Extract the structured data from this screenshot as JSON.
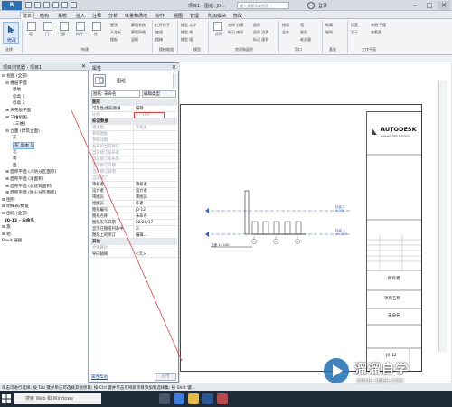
{
  "titlebar": {
    "app_logo": "R",
    "title": "项目1 - 图纸: J0...",
    "search_placeholder": "键入关键字或短语",
    "login": "登录",
    "minimize": "–",
    "maximize": "□",
    "close": "✕"
  },
  "ribbon_tabs": [
    "建筑",
    "结构",
    "系统",
    "插入",
    "注释",
    "分析",
    "体量和场地",
    "协作",
    "视图",
    "管理",
    "附加模块",
    "修改"
  ],
  "ribbon": {
    "modify": "修改",
    "select_panel": "选择",
    "buttons": [
      {
        "label": "墙"
      },
      {
        "label": "门"
      },
      {
        "label": "窗"
      },
      {
        "label": "构件"
      },
      {
        "label": "柱"
      },
      {
        "label": "屋顶"
      },
      {
        "label": "天花板"
      },
      {
        "label": "楼板"
      }
    ],
    "small_labels": [
      "幕墙系统",
      "幕墙网格",
      "竖梃",
      "栏杆扶手",
      "坡道",
      "楼梯",
      "模型 文字",
      "模型 线",
      "模型 组",
      "房间",
      "房间 分隔",
      "标记 房间",
      "面积",
      "面积 边界",
      "标记 面积",
      "按面",
      "竖井",
      "墙",
      "垂直",
      "老虎窗",
      "标高",
      "轴网",
      "设置",
      "显示",
      "参照 平面",
      "查看器"
    ],
    "panels": [
      "构建",
      "楼梯坡道",
      "模型",
      "房间和面积",
      "洞口",
      "基准",
      "工作平面"
    ]
  },
  "browser": {
    "title": "项目浏览器 - 项目1",
    "items": [
      {
        "text": "⊟ 视图 (全部)",
        "indent": 0
      },
      {
        "text": "⊟ 楼层平面",
        "indent": 1
      },
      {
        "text": "场地",
        "indent": 3
      },
      {
        "text": "标高 1",
        "indent": 3
      },
      {
        "text": "标高 2",
        "indent": 3
      },
      {
        "text": "⊞ 天花板平面",
        "indent": 1
      },
      {
        "text": "⊞ 三维视图",
        "indent": 1
      },
      {
        "text": "{三维}",
        "indent": 3
      },
      {
        "text": "⊟ 立面 (建筑立面)",
        "indent": 1
      },
      {
        "text": "东",
        "indent": 3
      },
      {
        "text": "东_副本 1",
        "indent": 3,
        "selected": true
      },
      {
        "text": "北",
        "indent": 3
      },
      {
        "text": "南",
        "indent": 3
      },
      {
        "text": "西",
        "indent": 3
      },
      {
        "text": "⊞ 面积平面 (人防分区面积)",
        "indent": 1
      },
      {
        "text": "⊞ 面积平面 (净面积)",
        "indent": 1
      },
      {
        "text": "⊞ 面积平面 (总建筑面积)",
        "indent": 1
      },
      {
        "text": "⊞ 面积平面 (防火分区面积)",
        "indent": 1
      },
      {
        "text": "⊞ 图例",
        "indent": 0
      },
      {
        "text": "⊞ 明细表/数量",
        "indent": 0
      },
      {
        "text": "⊟ 图纸 (全部)",
        "indent": 0
      },
      {
        "text": "J0-12 - 未命名",
        "indent": 1,
        "bold": true
      },
      {
        "text": "⊞ 族",
        "indent": 0
      },
      {
        "text": "⊞ 组",
        "indent": 0
      },
      {
        "text": "Revit 链接",
        "indent": 0
      }
    ]
  },
  "properties": {
    "title": "属性",
    "close": "✕",
    "type_name": "图纸",
    "filter_value": "图纸: 未命名",
    "edit_type": "编辑类型",
    "group_graphics": "图形",
    "group_identity": "标识数据",
    "group_other": "其他",
    "rows_graphics": [
      {
        "name": "可见性/图形替换",
        "value": "编辑...",
        "dim": false
      },
      {
        "name": "比例",
        "value": "1 : 100",
        "dim": true
      }
    ],
    "rows_identity": [
      {
        "name": "相关性",
        "value": "不相关",
        "dim": true
      },
      {
        "name": "参照图纸",
        "value": "",
        "dim": true
      },
      {
        "name": "参照详图",
        "value": "",
        "dim": true
      },
      {
        "name": "发布的当前修订",
        "value": "",
        "dim": true
      },
      {
        "name": "当前修订发布者",
        "value": "",
        "dim": true
      },
      {
        "name": "当前修订发布到",
        "value": "",
        "dim": true
      },
      {
        "name": "当前修订日期",
        "value": "",
        "dim": true
      },
      {
        "name": "当前修订说明",
        "value": "",
        "dim": true
      },
      {
        "name": "当前修订",
        "value": "",
        "dim": true
      },
      {
        "name": "审核者",
        "value": "审核者",
        "dim": false
      },
      {
        "name": "设计者",
        "value": "设计者",
        "dim": false
      },
      {
        "name": "审图员",
        "value": "审图员",
        "dim": false
      },
      {
        "name": "绘图员",
        "value": "作者",
        "dim": false
      },
      {
        "name": "图纸编号",
        "value": "J0-12",
        "dim": false
      },
      {
        "name": "图纸名称",
        "value": "未命名",
        "dim": false
      },
      {
        "name": "图纸发布日期",
        "value": "02/26/17",
        "dim": false
      },
      {
        "name": "显示在图纸列表中",
        "value": "☑",
        "dim": false
      },
      {
        "name": "图纸上的修订",
        "value": "编辑...",
        "dim": false
      }
    ],
    "rows_other": [
      {
        "name": "文件路径",
        "value": "",
        "dim": true
      },
      {
        "name": "导向轴网",
        "value": "<无>",
        "dim": false
      }
    ],
    "help": "属性帮助",
    "apply": "应用"
  },
  "sheet": {
    "logo_text": "AUTODESK",
    "logo_sub": "www.autodesk.com/revit",
    "owner": "所有者",
    "project_name": "项目名称",
    "unnamed": "未命名",
    "sheet_number": "J0-12",
    "level_labels": [
      "标高 2",
      "标高 1"
    ],
    "level_values": [
      "4.000",
      "±0.000"
    ],
    "section_labels": [
      "1",
      "2",
      "3"
    ],
    "elev_tag": "立面 1 : 100"
  },
  "status": {
    "text": "单击可进行选择; 按 Tab 键并单击可选择其他项目; 按 Ctrl 键并单击可将新项目添加到选择集; 按 Shift 键..."
  },
  "taskbar": {
    "search_placeholder": "搜索 Web 和 Windows"
  },
  "watermark": {
    "name": "溜溜自学",
    "url": "ZIXUE.3D66.COM"
  }
}
